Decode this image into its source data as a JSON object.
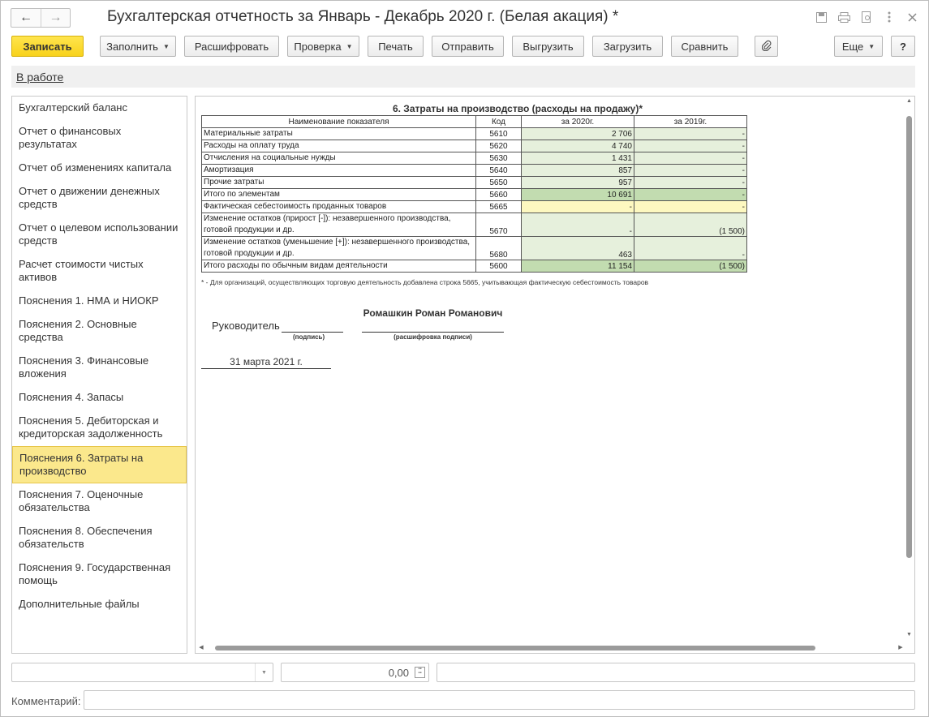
{
  "window": {
    "title": "Бухгалтерская отчетность за Январь - Декабрь 2020 г. (Белая акация) *",
    "nav_back": "←",
    "nav_forward": "→"
  },
  "toolbar": {
    "save": "Записать",
    "fill": "Заполнить",
    "decode": "Расшифровать",
    "check": "Проверка",
    "print": "Печать",
    "send": "Отправить",
    "export": "Выгрузить",
    "import": "Загрузить",
    "compare": "Сравнить",
    "attach": "📎",
    "more": "Еще",
    "help": "?"
  },
  "status": {
    "link": "В работе"
  },
  "sidebar": {
    "items": [
      {
        "label": "Бухгалтерский баланс"
      },
      {
        "label": "Отчет о финансовых результатах"
      },
      {
        "label": "Отчет об изменениях капитала"
      },
      {
        "label": "Отчет о движении денежных средств"
      },
      {
        "label": "Отчет о целевом использовании средств"
      },
      {
        "label": "Расчет стоимости чистых активов"
      },
      {
        "label": "Пояснения 1. НМА и НИОКР"
      },
      {
        "label": "Пояснения 2. Основные средства"
      },
      {
        "label": "Пояснения 3. Финансовые вложения"
      },
      {
        "label": "Пояснения 4. Запасы"
      },
      {
        "label": "Пояснения 5. Дебиторская и кредиторская задолженность"
      },
      {
        "label": "Пояснения 6. Затраты на производство"
      },
      {
        "label": "Пояснения 7. Оценочные обязательства"
      },
      {
        "label": "Пояснения 8. Обеспечения обязательств"
      },
      {
        "label": "Пояснения 9. Государственная помощь"
      },
      {
        "label": "Дополнительные файлы"
      }
    ],
    "selected_index": 11
  },
  "report": {
    "title": "6. Затраты на производство (расходы на продажу)*",
    "headers": {
      "name": "Наименование показателя",
      "code": "Код",
      "year1": "за 2020г.",
      "year2": "за 2019г."
    },
    "rows": [
      {
        "name": "Материальные затраты",
        "code": "5610",
        "v1": "2 706",
        "v2": "-"
      },
      {
        "name": "Расходы на оплату труда",
        "code": "5620",
        "v1": "4 740",
        "v2": "-"
      },
      {
        "name": "Отчисления на социальные нужды",
        "code": "5630",
        "v1": "1 431",
        "v2": "-"
      },
      {
        "name": "Амортизация",
        "code": "5640",
        "v1": "857",
        "v2": "-"
      },
      {
        "name": "Прочие затраты",
        "code": "5650",
        "v1": "957",
        "v2": "-"
      },
      {
        "name": "Итого по элементам",
        "code": "5660",
        "v1": "10 691",
        "v2": "-"
      },
      {
        "name": "Фактическая себестоимость проданных товаров",
        "code": "5665",
        "v1": "-",
        "v2": "-"
      },
      {
        "name": "Изменение остатков (прирост [-]): незавершенного производства, готовой продукции и др.",
        "code": "5670",
        "v1": "-",
        "v2": "(1 500)"
      },
      {
        "name": "Изменение остатков (уменьшение [+]): незавершенного производства, готовой продукции и др.",
        "code": "5680",
        "v1": "463",
        "v2": "-"
      },
      {
        "name": "Итого расходы по обычным видам деятельности",
        "code": "5600",
        "v1": "11 154",
        "v2": "(1 500)"
      }
    ],
    "footnote": "* - Для организаций, осуществляющих торговую деятельность добавлена строка 5665, учитывающая фактическую себестоимость товаров",
    "signature": {
      "role": "Руководитель",
      "sign_caption": "(подпись)",
      "name": "Ромашкин Роман Романович",
      "name_caption": "(расшифровка подписи)",
      "date": "31 марта 2021 г."
    }
  },
  "bottom": {
    "amount": "0,00",
    "comment_label": "Комментарий:"
  }
}
